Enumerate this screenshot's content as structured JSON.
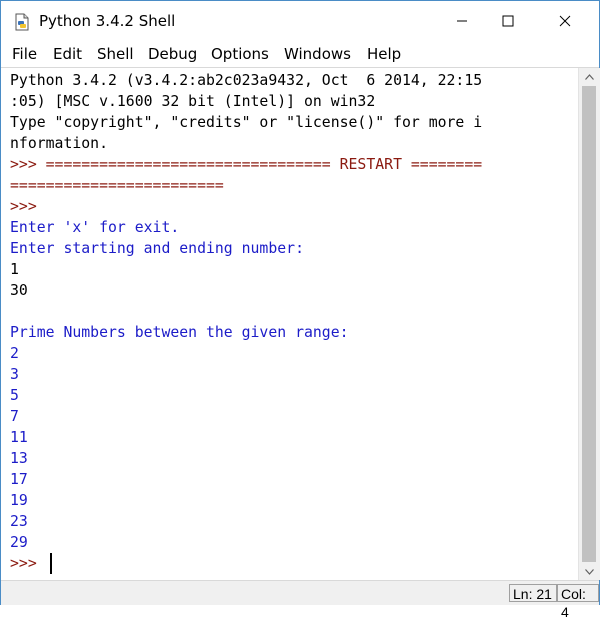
{
  "window": {
    "title": "Python 3.4.2 Shell"
  },
  "menu": [
    "File",
    "Edit",
    "Shell",
    "Debug",
    "Options",
    "Windows",
    "Help"
  ],
  "shell": {
    "lines": [
      {
        "text": "Python 3.4.2 (v3.4.2:ab2c023a9432, Oct  6 2014, 22:15",
        "kind": "out"
      },
      {
        "text": ":05) [MSC v.1600 32 bit (Intel)] on win32",
        "kind": "out"
      },
      {
        "text": "Type \"copyright\", \"credits\" or \"license()\" for more i",
        "kind": "out"
      },
      {
        "text": "nformation.",
        "kind": "out"
      },
      {
        "text": ">>> ================================ RESTART ========",
        "kind": "prompt"
      },
      {
        "text": "========================",
        "kind": "prompt"
      },
      {
        "text": ">>>",
        "kind": "prompt"
      },
      {
        "text": "Enter 'x' for exit.",
        "kind": "blue"
      },
      {
        "text": "Enter starting and ending number:",
        "kind": "blue"
      },
      {
        "text": "1",
        "kind": "out"
      },
      {
        "text": "30",
        "kind": "out"
      },
      {
        "text": "",
        "kind": "out"
      },
      {
        "text": "Prime Numbers between the given range:",
        "kind": "blue"
      },
      {
        "text": "2",
        "kind": "blue"
      },
      {
        "text": "3",
        "kind": "blue"
      },
      {
        "text": "5",
        "kind": "blue"
      },
      {
        "text": "7",
        "kind": "blue"
      },
      {
        "text": "11",
        "kind": "blue"
      },
      {
        "text": "13",
        "kind": "blue"
      },
      {
        "text": "17",
        "kind": "blue"
      },
      {
        "text": "19",
        "kind": "blue"
      },
      {
        "text": "23",
        "kind": "blue"
      },
      {
        "text": "29",
        "kind": "blue"
      },
      {
        "text": ">>> ",
        "kind": "prompt"
      }
    ]
  },
  "status": {
    "line": "Ln: 21",
    "col": "Col: 4"
  },
  "colors": {
    "output": "#000000",
    "prompt": "#8b1a10",
    "stdout": "#1c1cc8"
  }
}
